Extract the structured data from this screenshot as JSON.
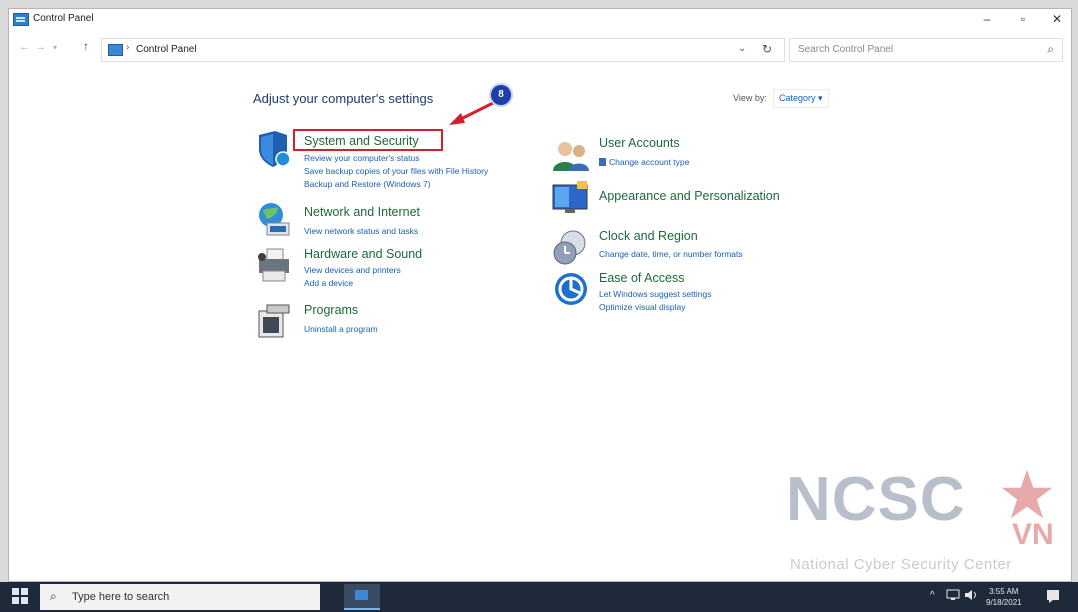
{
  "window": {
    "title": "Control Panel",
    "controls": {
      "minimize": "–",
      "maximize": "▫",
      "close": "✕"
    }
  },
  "address_bar": {
    "back": "←",
    "forward": "→",
    "recent": "▾",
    "up": "↑",
    "separator": "›",
    "breadcrumb": "Control Panel",
    "dropdown": "⌄",
    "refresh": "↻"
  },
  "search": {
    "placeholder": "Search Control Panel",
    "icon_glyph": "⌕"
  },
  "main": {
    "heading": "Adjust your computer's settings",
    "step_badge": "8",
    "view_by": {
      "label": "View by:",
      "value": "Category ▾"
    }
  },
  "categories": {
    "system_security": {
      "title": "System and Security",
      "links": [
        "Review your computer's status",
        "Save backup copies of your files with File History",
        "Backup and Restore (Windows 7)"
      ]
    },
    "network": {
      "title": "Network and Internet",
      "links": [
        "View network status and tasks"
      ]
    },
    "hardware": {
      "title": "Hardware and Sound",
      "links": [
        "View devices and printers",
        "Add a device"
      ]
    },
    "programs": {
      "title": "Programs",
      "links": [
        "Uninstall a program"
      ]
    },
    "user_accounts": {
      "title": "User Accounts",
      "links": [
        "Change account type"
      ]
    },
    "appearance": {
      "title": "Appearance and Personalization",
      "links": []
    },
    "clock": {
      "title": "Clock and Region",
      "links": [
        "Change date, time, or number formats"
      ]
    },
    "ease": {
      "title": "Ease of Access",
      "links": [
        "Let Windows suggest settings",
        "Optimize visual display"
      ]
    }
  },
  "watermark": {
    "letters": "NCSC",
    "sub_letters": "VN",
    "subtitle": "National Cyber Security Center"
  },
  "taskbar": {
    "search_text": "Type here to search",
    "search_icon_glyph": "⌕",
    "tray": {
      "chevron": "^",
      "time": "3:55 AM",
      "date": "9/18/2021"
    }
  },
  "colors": {
    "link_blue": "#1a5fb4",
    "category_green": "#1b6a3a",
    "highlight_red": "#d41f2b",
    "badge_blue": "#1e3fa8",
    "taskbar": "#1e2a3a"
  }
}
